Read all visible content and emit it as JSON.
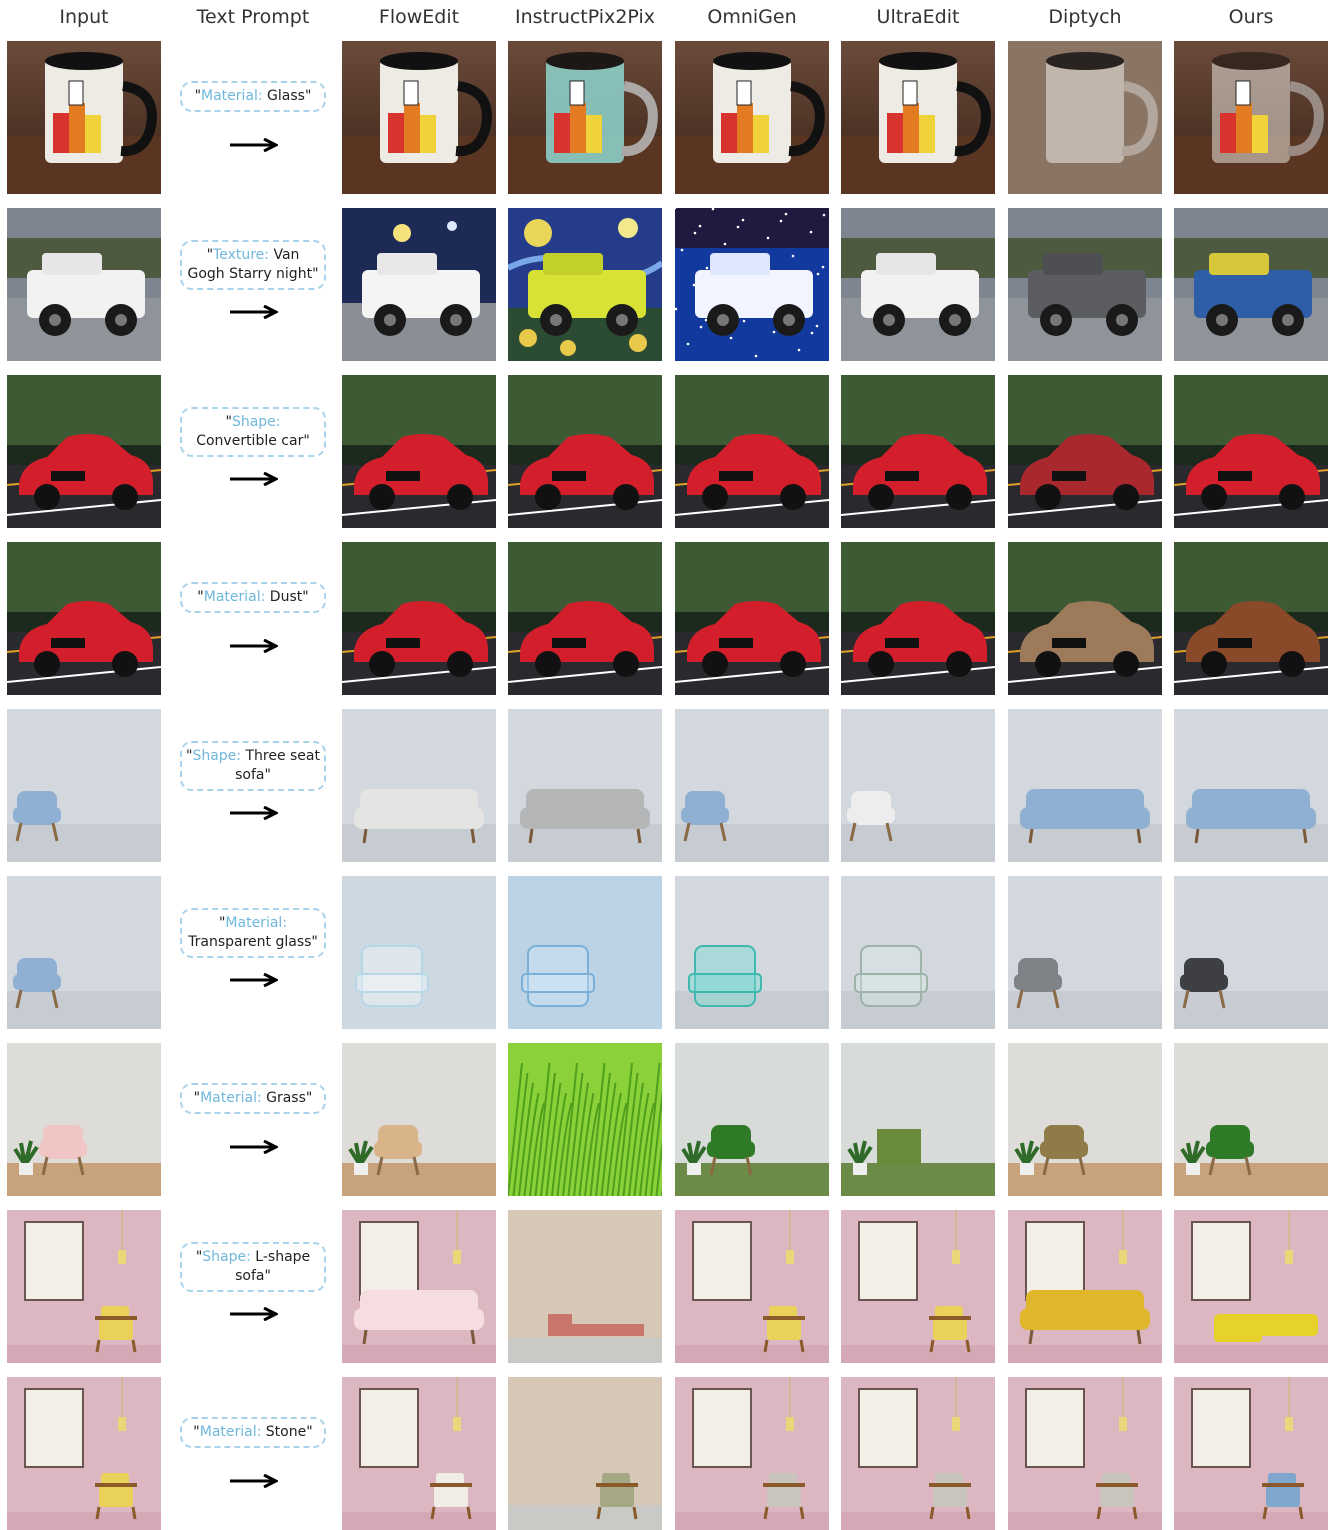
{
  "headers": [
    "Input",
    "Text Prompt",
    "FlowEdit",
    "InstructPix2Pix",
    "OmniGen",
    "UltraEdit",
    "Diptych",
    "Ours"
  ],
  "rows": [
    {
      "prompt_keyword": "Material:",
      "prompt_value": "Glass",
      "scene": "mug",
      "cells": [
        "mug-plain",
        "mug-plain",
        "mug-glass-color",
        "mug-plain",
        "mug-plain",
        "mug-frosted",
        "mug-glass"
      ]
    },
    {
      "prompt_keyword": "Texture:",
      "prompt_value": "Van Gogh Starry night",
      "scene": "jeep",
      "cells": [
        "jeep-white",
        "jeep-night",
        "jeep-vangogh",
        "jeep-starry-blue",
        "jeep-white",
        "jeep-grey",
        "jeep-painted"
      ]
    },
    {
      "prompt_keyword": "Shape:",
      "prompt_value": "Convertible car",
      "scene": "car",
      "cells": [
        "car-red",
        "car-red",
        "car-red",
        "car-red",
        "car-red",
        "car-darkred",
        "car-red"
      ]
    },
    {
      "prompt_keyword": "Material:",
      "prompt_value": "Dust",
      "scene": "car",
      "cells": [
        "car-red",
        "car-red",
        "car-red",
        "car-red",
        "car-red",
        "car-dust-blur",
        "car-rust"
      ]
    },
    {
      "prompt_keyword": "Shape:",
      "prompt_value": "Three seat sofa",
      "scene": "chair",
      "cells": [
        "chair-blue",
        "sofa-white",
        "sofa-grey",
        "chair-blue",
        "chair-white",
        "sofa-blue",
        "sofa-blue"
      ]
    },
    {
      "prompt_keyword": "Material:",
      "prompt_value": "Transparent glass",
      "scene": "chair",
      "cells": [
        "chair-blue",
        "glass-big",
        "glass-blue",
        "glass-teal",
        "glass-clear",
        "chair-grey",
        "chair-dark"
      ]
    },
    {
      "prompt_keyword": "Material:",
      "prompt_value": "Grass",
      "scene": "room",
      "cells": [
        "room-pink-chair",
        "room-tan-chair",
        "grass-field",
        "grass-chair",
        "grass-block",
        "room-olive-chair",
        "grass-chair-room"
      ]
    },
    {
      "prompt_keyword": "Shape:",
      "prompt_value": "L-shape sofa",
      "scene": "pink",
      "cells": [
        "pink-yellow-chair",
        "pink-white-sofa",
        "beige-l-sofa",
        "pink-yellow-chair",
        "pink-yellow-chair",
        "pink-yellow-sofa",
        "pink-l-sofa"
      ]
    },
    {
      "prompt_keyword": "Material:",
      "prompt_value": "Stone",
      "scene": "pink",
      "cells": [
        "pink-yellow-chair",
        "pink-white-chair",
        "beige-stone",
        "pink-stone-chair",
        "pink-stone-chair",
        "pink-stone-chair",
        "pink-blue-chair"
      ]
    }
  ]
}
